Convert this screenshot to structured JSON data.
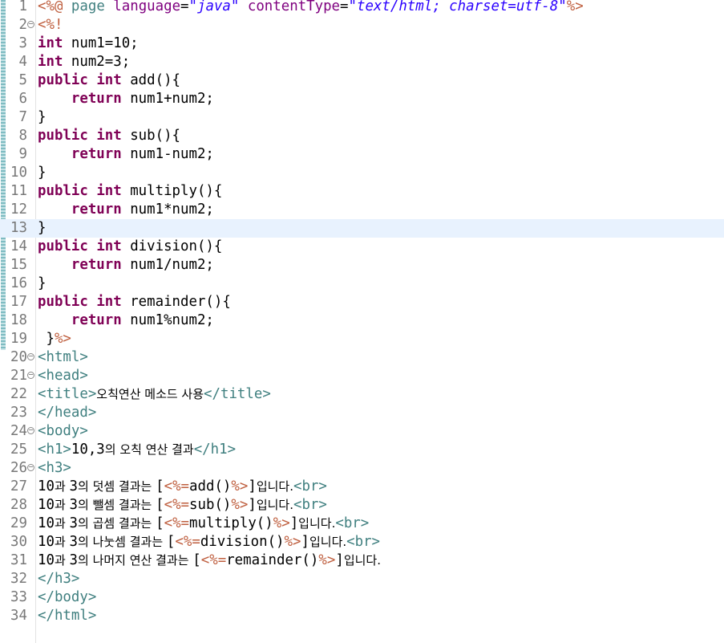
{
  "colors": {
    "jsp_delimiter": "#bf5f3f",
    "jsp_directive": "#3f7f7f",
    "attribute_name": "#7f007f",
    "string_literal": "#2a00ff",
    "java_keyword": "#7f0055",
    "html_tag": "#3f7f7f",
    "line_number": "#787878",
    "current_line_bg": "#e8f2fe"
  },
  "editor": {
    "current_line": 13,
    "lines": [
      {
        "n": "1",
        "fold": false,
        "segs": [
          [
            "delim",
            "<%@"
          ],
          [
            "txt",
            " "
          ],
          [
            "jsp",
            "page"
          ],
          [
            "txt",
            " "
          ],
          [
            "attr",
            "language"
          ],
          [
            "txt",
            "="
          ],
          [
            "str",
            "\"java\""
          ],
          [
            "txt",
            " "
          ],
          [
            "attr",
            "contentType"
          ],
          [
            "txt",
            "="
          ],
          [
            "str",
            "\"text/html; charset=utf-8\""
          ],
          [
            "delim",
            "%>"
          ]
        ]
      },
      {
        "n": "2",
        "fold": true,
        "segs": [
          [
            "delim",
            "<%!"
          ]
        ]
      },
      {
        "n": "3",
        "fold": false,
        "segs": [
          [
            "kw",
            "int"
          ],
          [
            "txt",
            " num1=10;"
          ]
        ]
      },
      {
        "n": "4",
        "fold": false,
        "segs": [
          [
            "kw",
            "int"
          ],
          [
            "txt",
            " num2=3;"
          ]
        ]
      },
      {
        "n": "5",
        "fold": false,
        "segs": [
          [
            "kw",
            "public"
          ],
          [
            "txt",
            " "
          ],
          [
            "kw",
            "int"
          ],
          [
            "txt",
            " add(){"
          ]
        ]
      },
      {
        "n": "6",
        "fold": false,
        "segs": [
          [
            "txt",
            "    "
          ],
          [
            "kw",
            "return"
          ],
          [
            "txt",
            " num1+num2;"
          ]
        ]
      },
      {
        "n": "7",
        "fold": false,
        "segs": [
          [
            "txt",
            "}"
          ]
        ]
      },
      {
        "n": "8",
        "fold": false,
        "segs": [
          [
            "kw",
            "public"
          ],
          [
            "txt",
            " "
          ],
          [
            "kw",
            "int"
          ],
          [
            "txt",
            " sub(){"
          ]
        ]
      },
      {
        "n": "9",
        "fold": false,
        "segs": [
          [
            "txt",
            "    "
          ],
          [
            "kw",
            "return"
          ],
          [
            "txt",
            " num1-num2;"
          ]
        ]
      },
      {
        "n": "10",
        "fold": false,
        "segs": [
          [
            "txt",
            "}"
          ]
        ]
      },
      {
        "n": "11",
        "fold": false,
        "segs": [
          [
            "kw",
            "public"
          ],
          [
            "txt",
            " "
          ],
          [
            "kw",
            "int"
          ],
          [
            "txt",
            " multiply(){"
          ]
        ]
      },
      {
        "n": "12",
        "fold": false,
        "segs": [
          [
            "txt",
            "    "
          ],
          [
            "kw",
            "return"
          ],
          [
            "txt",
            " num1*num2;"
          ]
        ]
      },
      {
        "n": "13",
        "fold": false,
        "segs": [
          [
            "txt",
            "}"
          ]
        ]
      },
      {
        "n": "14",
        "fold": false,
        "segs": [
          [
            "kw",
            "public"
          ],
          [
            "txt",
            " "
          ],
          [
            "kw",
            "int"
          ],
          [
            "txt",
            " division(){"
          ]
        ]
      },
      {
        "n": "15",
        "fold": false,
        "segs": [
          [
            "txt",
            "    "
          ],
          [
            "kw",
            "return"
          ],
          [
            "txt",
            " num1/num2;"
          ]
        ]
      },
      {
        "n": "16",
        "fold": false,
        "segs": [
          [
            "txt",
            "}"
          ]
        ]
      },
      {
        "n": "17",
        "fold": false,
        "segs": [
          [
            "kw",
            "public"
          ],
          [
            "txt",
            " "
          ],
          [
            "kw",
            "int"
          ],
          [
            "txt",
            " remainder(){"
          ]
        ]
      },
      {
        "n": "18",
        "fold": false,
        "segs": [
          [
            "txt",
            "    "
          ],
          [
            "kw",
            "return"
          ],
          [
            "txt",
            " num1%num2;"
          ]
        ]
      },
      {
        "n": "19",
        "fold": false,
        "segs": [
          [
            "txt",
            " }"
          ],
          [
            "delim",
            "%>"
          ]
        ]
      },
      {
        "n": "20",
        "fold": true,
        "segs": [
          [
            "tag",
            "<html>"
          ]
        ]
      },
      {
        "n": "21",
        "fold": true,
        "segs": [
          [
            "tag",
            "<head>"
          ]
        ]
      },
      {
        "n": "22",
        "fold": false,
        "segs": [
          [
            "tag",
            "<title>"
          ],
          [
            "kor",
            "오칙연산 메소드 사용"
          ],
          [
            "tag",
            "</title>"
          ]
        ]
      },
      {
        "n": "23",
        "fold": false,
        "segs": [
          [
            "tag",
            "</head>"
          ]
        ]
      },
      {
        "n": "24",
        "fold": true,
        "segs": [
          [
            "tag",
            "<body>"
          ]
        ]
      },
      {
        "n": "25",
        "fold": false,
        "segs": [
          [
            "tag",
            "<h1>"
          ],
          [
            "txt",
            "10,3"
          ],
          [
            "kor",
            "의 오칙 연산 결과"
          ],
          [
            "tag",
            "</h1>"
          ]
        ]
      },
      {
        "n": "26",
        "fold": true,
        "segs": [
          [
            "tag",
            "<h3>"
          ]
        ]
      },
      {
        "n": "27",
        "fold": false,
        "segs": [
          [
            "txt",
            "10"
          ],
          [
            "kor",
            "과 "
          ],
          [
            "txt",
            "3"
          ],
          [
            "kor",
            "의 덧셈 결과는 "
          ],
          [
            "txt",
            "["
          ],
          [
            "delim",
            "<%="
          ],
          [
            "txt",
            "add()"
          ],
          [
            "delim",
            "%>"
          ],
          [
            "txt",
            "]"
          ],
          [
            "kor",
            "입니다."
          ],
          [
            "tag",
            "<br>"
          ]
        ]
      },
      {
        "n": "28",
        "fold": false,
        "segs": [
          [
            "txt",
            "10"
          ],
          [
            "kor",
            "과 "
          ],
          [
            "txt",
            "3"
          ],
          [
            "kor",
            "의 뺄셈 결과는 "
          ],
          [
            "txt",
            "["
          ],
          [
            "delim",
            "<%="
          ],
          [
            "txt",
            "sub()"
          ],
          [
            "delim",
            "%>"
          ],
          [
            "txt",
            "]"
          ],
          [
            "kor",
            "입니다."
          ],
          [
            "tag",
            "<br>"
          ]
        ]
      },
      {
        "n": "29",
        "fold": false,
        "segs": [
          [
            "txt",
            "10"
          ],
          [
            "kor",
            "과 "
          ],
          [
            "txt",
            "3"
          ],
          [
            "kor",
            "의 곱셈 결과는 "
          ],
          [
            "txt",
            "["
          ],
          [
            "delim",
            "<%="
          ],
          [
            "txt",
            "multiply()"
          ],
          [
            "delim",
            "%>"
          ],
          [
            "txt",
            "]"
          ],
          [
            "kor",
            "입니다."
          ],
          [
            "tag",
            "<br>"
          ]
        ]
      },
      {
        "n": "30",
        "fold": false,
        "segs": [
          [
            "txt",
            "10"
          ],
          [
            "kor",
            "과 "
          ],
          [
            "txt",
            "3"
          ],
          [
            "kor",
            "의 나눗셈 결과는 "
          ],
          [
            "txt",
            "["
          ],
          [
            "delim",
            "<%="
          ],
          [
            "txt",
            "division()"
          ],
          [
            "delim",
            "%>"
          ],
          [
            "txt",
            "]"
          ],
          [
            "kor",
            "입니다."
          ],
          [
            "tag",
            "<br>"
          ]
        ]
      },
      {
        "n": "31",
        "fold": false,
        "segs": [
          [
            "txt",
            "10"
          ],
          [
            "kor",
            "과 "
          ],
          [
            "txt",
            "3"
          ],
          [
            "kor",
            "의 나머지 연산 결과는 "
          ],
          [
            "txt",
            "["
          ],
          [
            "delim",
            "<%="
          ],
          [
            "txt",
            "remainder()"
          ],
          [
            "delim",
            "%>"
          ],
          [
            "txt",
            "]"
          ],
          [
            "kor",
            "입니다."
          ]
        ]
      },
      {
        "n": "32",
        "fold": false,
        "segs": [
          [
            "tag",
            "</h3>"
          ]
        ]
      },
      {
        "n": "33",
        "fold": false,
        "segs": [
          [
            "tag",
            "</body>"
          ]
        ]
      },
      {
        "n": "34",
        "fold": false,
        "segs": [
          [
            "tag",
            "</html>"
          ]
        ]
      }
    ]
  }
}
